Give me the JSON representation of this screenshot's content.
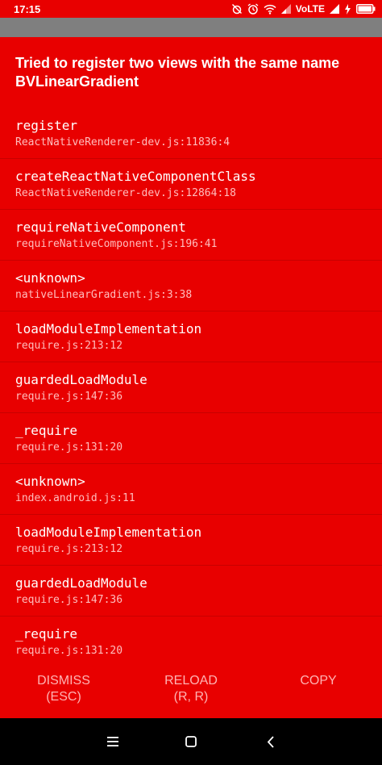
{
  "status_bar": {
    "time": "17:15",
    "network_label": "VoLTE",
    "icons": [
      "alarm-off-icon",
      "alarm-icon",
      "wifi-icon",
      "signal-icon",
      "signal-icon",
      "battery-charging-icon"
    ]
  },
  "error": {
    "title": "Tried to register two views with the same name BVLinearGradient"
  },
  "stack_frames": [
    {
      "method": "register",
      "location": "ReactNativeRenderer-dev.js:11836:4"
    },
    {
      "method": "createReactNativeComponentClass",
      "location": "ReactNativeRenderer-dev.js:12864:18"
    },
    {
      "method": "requireNativeComponent",
      "location": "requireNativeComponent.js:196:41"
    },
    {
      "method": "<unknown>",
      "location": "nativeLinearGradient.js:3:38"
    },
    {
      "method": "loadModuleImplementation",
      "location": "require.js:213:12"
    },
    {
      "method": "guardedLoadModule",
      "location": "require.js:147:36"
    },
    {
      "method": "_require",
      "location": "require.js:131:20"
    },
    {
      "method": "<unknown>",
      "location": "index.android.js:11"
    },
    {
      "method": "loadModuleImplementation",
      "location": "require.js:213:12"
    },
    {
      "method": "guardedLoadModule",
      "location": "require.js:147:36"
    },
    {
      "method": "_require",
      "location": "require.js:131:20"
    }
  ],
  "buttons": {
    "dismiss": {
      "label": "DISMISS",
      "shortcut": "(ESC)"
    },
    "reload": {
      "label": "RELOAD",
      "shortcut": "(R, R)"
    },
    "copy": {
      "label": "COPY"
    }
  },
  "nav_bar": {
    "icons": [
      "menu-icon",
      "home-icon",
      "back-icon"
    ]
  },
  "colors": {
    "background": "#e80000",
    "grey_band": "#7f7f7f",
    "location_text": "#ffbdbd",
    "button_text": "#ffb3b3",
    "nav_bar": "#000000"
  }
}
